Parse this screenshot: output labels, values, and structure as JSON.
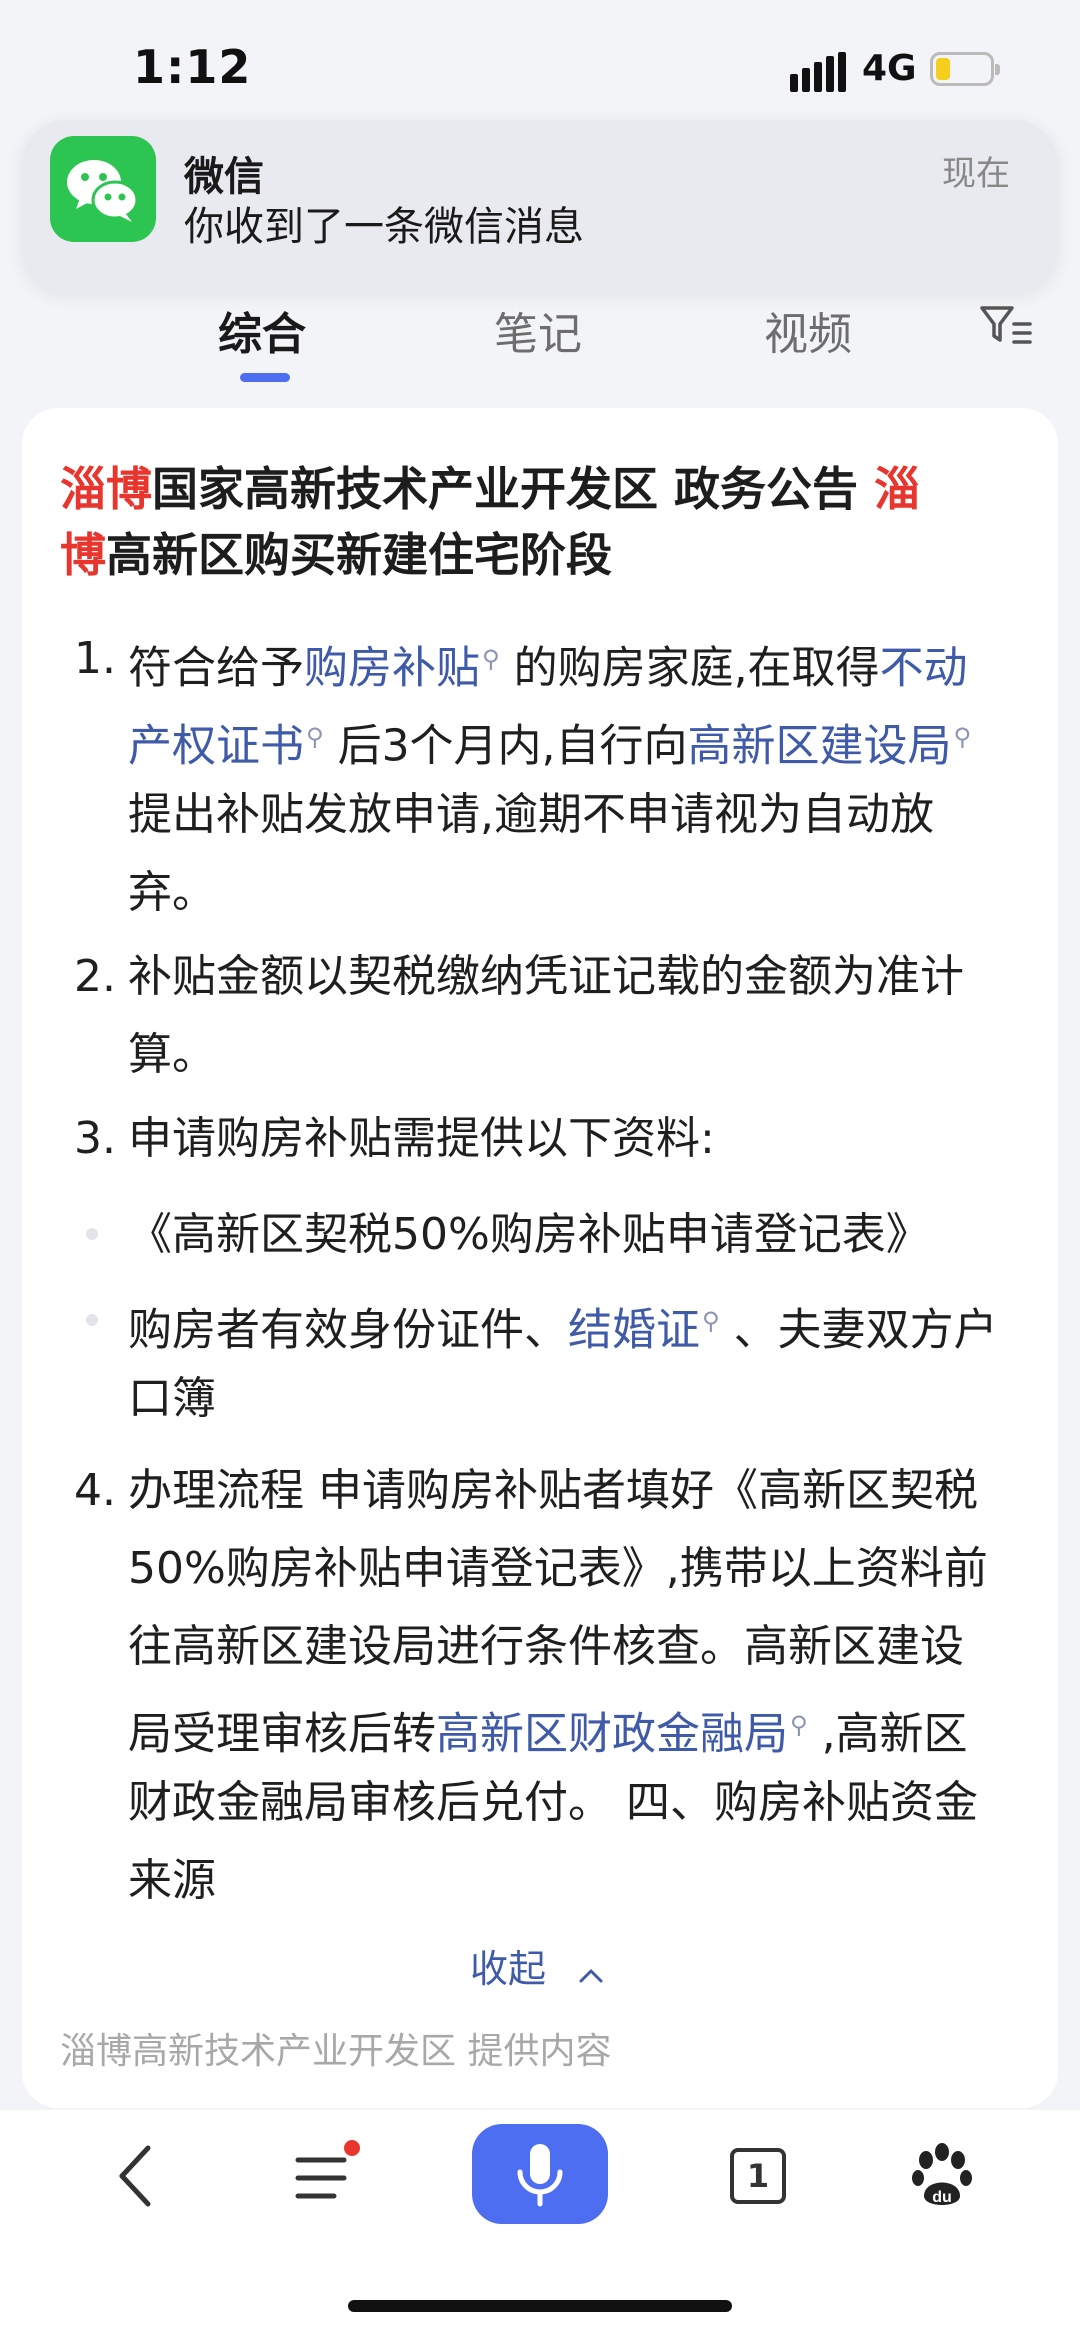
{
  "status_bar": {
    "time": "1:12",
    "network": "4G"
  },
  "notification": {
    "app": "微信",
    "message": "你收到了一条微信消息",
    "time": "现在"
  },
  "tabs": [
    {
      "label": "综合",
      "active": true
    },
    {
      "label": "笔记",
      "active": false
    },
    {
      "label": "视频",
      "active": false
    }
  ],
  "article": {
    "title_parts": [
      "淄博",
      "国家高新技术产业开发区 政务公告 ",
      "淄",
      "博",
      "高新区购买新建住宅阶段"
    ],
    "item1": {
      "num": "1.",
      "l1a": "符合给予",
      "l1link": "购房补贴",
      "l1b": " 的购房家庭,在取得",
      "l1link2": "不动",
      "l2link": "产权证书",
      "l2b": " 后3个月内,自行向",
      "l2link2": "高新区建设局",
      "l3": "提出补贴发放申请,逾期不申请视为自动放",
      "l4": "弃。"
    },
    "item2": {
      "num": "2.",
      "l1": "补贴金额以契税缴纳凭证记载的金额为准计",
      "l2": "算。"
    },
    "item3": {
      "num": "3.",
      "l1": "申请购房补贴需提供以下资料:"
    },
    "bullets": {
      "b1": "《高新区契税50%购房补贴申请登记表》",
      "b2a": "购房者有效身份证件、",
      "b2link": "结婚证",
      "b2b": " 、夫妻双方户",
      "b2c": "口簿"
    },
    "item4": {
      "num": "4.",
      "l1": "办理流程 申请购房补贴者填好《高新区契税",
      "l2": "50%购房补贴申请登记表》,携带以上资料前",
      "l3": "往高新区建设局进行条件核查。高新区建设",
      "l4a": "局受理审核后转",
      "l4link": "高新区财政金融局",
      "l4b": " ,高新区",
      "l5": "财政金融局审核后兑付。 四、购房补贴资金",
      "l6": "来源"
    },
    "collapse": "收起",
    "source": "淄博高新技术产业开发区  提供内容"
  },
  "bottom_nav": {
    "tab_count": "1"
  },
  "colors": {
    "accent": "#4e6ef2",
    "highlight_red": "#e8352e",
    "link": "#3f5aa8",
    "wechat_green": "#2dc551"
  }
}
